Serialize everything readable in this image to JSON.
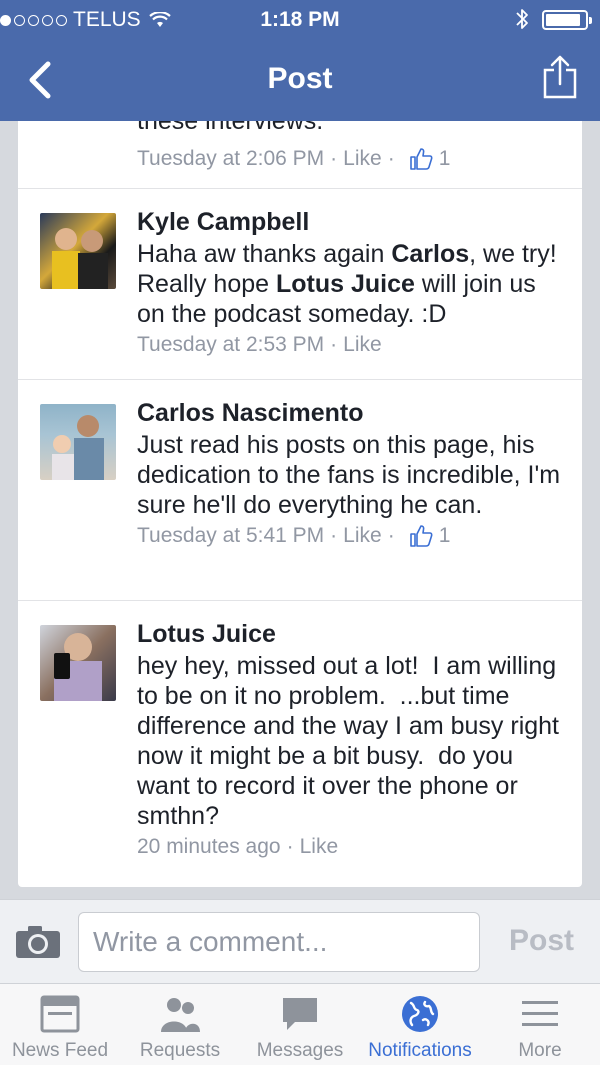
{
  "status_bar": {
    "carrier": "TELUS",
    "time": "1:18 PM"
  },
  "nav": {
    "title": "Post"
  },
  "fragment": {
    "text": "these interviews.",
    "timestamp": "Tuesday at 2:06 PM",
    "like_label": "Like",
    "like_count": "1"
  },
  "comments": [
    {
      "author": "Kyle Campbell",
      "text_parts": [
        "Haha aw thanks again ",
        "Carlos",
        ", we try! Really hope ",
        "Lotus Juice",
        " will join us on the podcast someday. :D"
      ],
      "timestamp": "Tuesday at 2:53 PM",
      "like_label": "Like"
    },
    {
      "author": "Carlos Nascimento",
      "text": "Just read his posts on this page, his dedication to the fans is incredible, I'm sure he'll do everything he can.",
      "timestamp": "Tuesday at 5:41 PM",
      "like_label": "Like",
      "like_count": "1"
    },
    {
      "author": "Lotus Juice",
      "text": "hey hey, missed out a lot!  I am willing to be on it no problem.  ...but time difference and the way I am busy right now it might be a bit busy.  do you want to record it over the phone or smthn?",
      "timestamp": "20 minutes ago",
      "like_label": "Like"
    }
  ],
  "composer": {
    "placeholder": "Write a comment...",
    "post_label": "Post"
  },
  "tabs": [
    {
      "label": "News Feed",
      "icon": "news-feed-icon",
      "active": false
    },
    {
      "label": "Requests",
      "icon": "friend-requests-icon",
      "active": false
    },
    {
      "label": "Messages",
      "icon": "messages-icon",
      "active": false
    },
    {
      "label": "Notifications",
      "icon": "globe-icon",
      "active": true
    },
    {
      "label": "More",
      "icon": "menu-icon",
      "active": false
    }
  ],
  "colors": {
    "header": "#4a6aab",
    "active_tab": "#3b6fd4",
    "meta_text": "#9197a3"
  }
}
